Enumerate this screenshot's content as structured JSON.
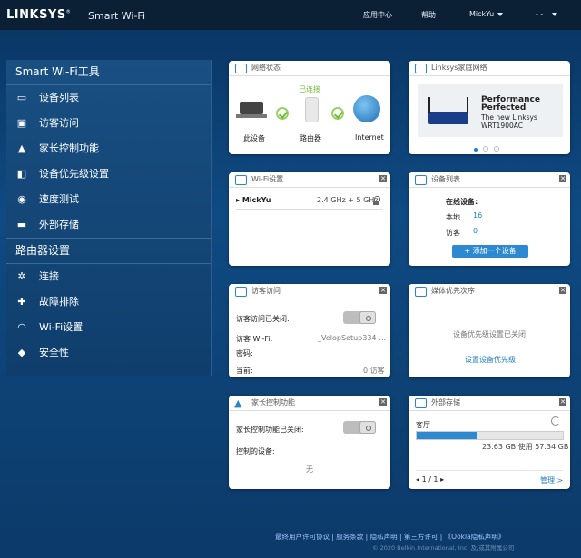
{
  "topbar": {
    "logo": "LINKSYS",
    "app_title": "Smart Wi-Fi",
    "nav1": "应用中心",
    "nav2": "帮助",
    "user": "MickYu",
    "lang": "- -"
  },
  "sidebar": {
    "section1": "Smart Wi-Fi工具",
    "items1": [
      "设备列表",
      "访客访问",
      "家长控制功能",
      "设备优先级设置",
      "速度测试",
      "外部存储"
    ],
    "section2": "路由器设置",
    "items2": [
      "连接",
      "故障排除",
      "Wi-Fi设置",
      "安全性"
    ]
  },
  "network": {
    "title": "网络状态",
    "status": "已连接",
    "device": "此设备",
    "router": "路由器",
    "internet": "Internet"
  },
  "linksys_net": {
    "title": "Linksys家庭网络",
    "line1": "Performance",
    "line2": "Perfected",
    "line3": "The new Linksys",
    "line4": "WRT1900AC"
  },
  "wifi": {
    "title": "Wi-Fi设置",
    "ssid": "MickYu",
    "band": "2.4 GHz + 5 GHz"
  },
  "devices": {
    "title": "设备列表",
    "online_label": "在线设备:",
    "local_label": "本地",
    "local_count": "16",
    "guest_label": "访客",
    "guest_count": "0",
    "add_label": "添加一个设备"
  },
  "guest": {
    "title": "访客访问",
    "off_label": "访客访问已关闭:",
    "wifi_label": "访客 Wi-Fi:",
    "wifi_value": "_VelopSetup334-...",
    "pwd_label": "密码:",
    "current_label": "当前:",
    "current_value": "0 访客"
  },
  "media": {
    "title": "媒体优先次序",
    "status": "设备优先级设置已关闭",
    "link": "设置设备优先级"
  },
  "parental": {
    "title": "家长控制功能",
    "off_label": "家长控制功能已关闭:",
    "controlled_label": "控制的设备:",
    "none": "无"
  },
  "storage": {
    "title": "外部存储",
    "name": "客厅",
    "usage": "23.63 GB 使用 57.34 GB",
    "used_fraction": 0.412,
    "page": "1 / 1",
    "manage": "管理 >"
  },
  "footer": {
    "links": "最终用户许可协议 | 服务条款 | 隐私声明 | 第三方许可 | 《Ookla隐私声明》",
    "copyright": "© 2020 Belkin International, Inc. 及/或其附属公司"
  },
  "colors": {
    "accent": "#2480c5",
    "topbar": "#0b1f35"
  }
}
